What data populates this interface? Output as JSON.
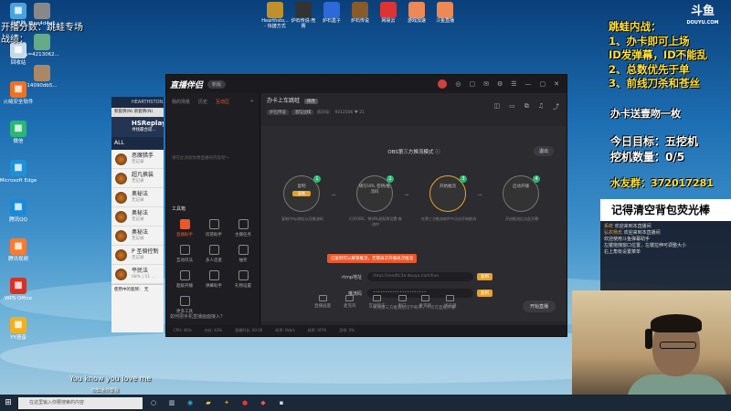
{
  "desktop_icons": [
    {
      "label": "此电脑",
      "icon": "computer-icon",
      "color": "#4aa3df"
    },
    {
      "label": "回收站",
      "icon": "recycle-bin-icon",
      "color": "#c8d8e8"
    },
    {
      "label": "火绒安全软件",
      "icon": "shield-icon",
      "color": "#f07020"
    },
    {
      "label": "微信",
      "icon": "wechat-icon",
      "color": "#2bb673"
    },
    {
      "label": "Microsoft Edge",
      "icon": "edge-icon",
      "color": "#1e90d8"
    },
    {
      "label": "腾讯QQ",
      "icon": "qq-icon",
      "color": "#1a8ad8"
    },
    {
      "label": "腾讯视频",
      "icon": "video-icon",
      "color": "#ff7a2b"
    },
    {
      "label": "WPS Office",
      "icon": "wps-icon",
      "color": "#d93025"
    },
    {
      "label": "YY语音",
      "icon": "yy-icon",
      "color": "#f2b01e"
    }
  ],
  "desktop_icons_col2": [
    {
      "label": "f1ee4d4a1",
      "icon": "file-icon",
      "color": "#888"
    },
    {
      "label": "u=4213062...",
      "icon": "image-icon",
      "color": "#6a8"
    },
    {
      "label": "14090db5...",
      "icon": "image-icon",
      "color": "#a86"
    }
  ],
  "top_icons": [
    {
      "label": "Hearthsto... - 快捷方式",
      "icon": "hearthstone-icon",
      "color": "#c0902a"
    },
    {
      "label": "炉石传说-竞赛",
      "icon": "game-icon",
      "color": "#333"
    },
    {
      "label": "炉石盒子",
      "icon": "box-icon",
      "color": "#2b6ad8"
    },
    {
      "label": "炉石传说",
      "icon": "hearthstone-icon",
      "color": "#8a5a2a"
    },
    {
      "label": "网易云",
      "icon": "music-icon",
      "color": "#d33"
    },
    {
      "label": "游戏加速",
      "icon": "rocket-icon",
      "color": "#e85"
    },
    {
      "label": "斗鱼直播",
      "icon": "fish-icon",
      "color": "#e85"
    }
  ],
  "overlay_left": {
    "line1": "开播分数：跳蛙专场",
    "line2": "战绩："
  },
  "overlay_right": {
    "title": "跳蛙内战：",
    "lines": [
      "1、办卡即可上场",
      "ID发弹幕，ID不能乱",
      "2、总数优先于单",
      "3、前线刀杀和苍丝"
    ],
    "promo": "办卡送壹吻一枚",
    "goal": "今日目标：五挖机",
    "count": "挖机数量：0/5",
    "group": "水友群：372017281"
  },
  "douyu": {
    "logo": "斗鱼",
    "sub": "DOUYU.COM"
  },
  "hearthstone": {
    "header": "HEARTHSTON...",
    "sub": "新套牌(N)  新套牌(N)",
    "replay_title": "HSReplay",
    "replay_sub": "寻找最合适...",
    "filter_all": "ALL",
    "players": [
      {
        "name": "恶魔猎手",
        "rec": "无记录"
      },
      {
        "name": "超凡换装",
        "rec": "无记录"
      },
      {
        "name": "奥秘法",
        "rec": "无记录"
      },
      {
        "name": "奥秘法",
        "rec": "无记录"
      },
      {
        "name": "奥秘法",
        "rec": "无记录"
      },
      {
        "name": "P 圣骑控制",
        "rec": "无记录"
      },
      {
        "name": "平民法",
        "rec": "68% | 51 ..."
      }
    ],
    "footer": "使用中的套牌：  无"
  },
  "app": {
    "logo": "直播伴侣",
    "version": "新版",
    "sidebar_tabs": [
      "我的场景",
      "历史",
      "互动区"
    ],
    "empty_text": "请在此添加你想直播的内容吧～",
    "tools_title": "工具箱",
    "tools": [
      "直播助手",
      "房管助手",
      "主播任务",
      "互动玩法",
      "多人连麦",
      "抽奖",
      "超级开播",
      "弹幕助手",
      "礼物设置",
      "更多工具"
    ],
    "sidebar_footer": "如何把手机直播画面接入？",
    "room_title": "办卡上车跳蛙",
    "room_chip": "修改",
    "room_tags": [
      "炉石传说",
      "酒馆战棋"
    ],
    "room_id_label": "房间号：",
    "room_id": "9312506",
    "fans": "21",
    "mode_title": "OBS第三方推流模式",
    "quit": "退出",
    "steps": [
      {
        "label": "复制",
        "caption": "复制rtmp地址以及推流码",
        "btn": "复制"
      },
      {
        "label": "填写URL 密钥/推流码",
        "caption": "打开OBS，将URL粘贴到设置-推流中",
        "btn": ""
      },
      {
        "label": "开始推流",
        "caption": "在第三方推流软件中点击开始推流",
        "btn": ""
      },
      {
        "label": "启动开播",
        "caption": "开启推流后点此开播",
        "btn": ""
      }
    ],
    "tip": "已复制可以解锁推流，无需再次开播再次推流",
    "rtmp_label": "rtmp地址",
    "rtmp_value": "rtmp://sendtc3a.douyu.com/live",
    "key_label": "推流码",
    "key_value": "••••••••••••••••••••••",
    "copy": "复制",
    "hint": "关闭第三方推流后可不断开，下次可直接开播",
    "bottom_tools": [
      "直播画面",
      "麦克风",
      "互动玩法",
      "窗口",
      "麦克风",
      "扬声器"
    ],
    "live_button": "开始直播",
    "status": [
      "CPU: 46%",
      "内存: 43%",
      "直播时长: 00:00",
      "码率: 0kb/s",
      "帧率: 0FPS",
      "丢帧: 0%"
    ]
  },
  "ribbon": "记得清空背包荧光棒",
  "chat": [
    {
      "u": "系统",
      "t": "欢迎来到本直播间"
    },
    {
      "u": "弘农杨氏",
      "t": "欢迎来到本直播间"
    },
    {
      "u": "",
      "t": "欢迎使用斗鱼弹幕助手"
    },
    {
      "u": "",
      "t": "左键拖拽窗口位置，左键拉伸可调整大小"
    },
    {
      "u": "",
      "t": "右上角有设置菜单"
    }
  ],
  "subtitle": "You know you love me",
  "subtitle2": "你知道你爱我",
  "taskbar": {
    "search": "在这里输入你要搜索的内容"
  }
}
